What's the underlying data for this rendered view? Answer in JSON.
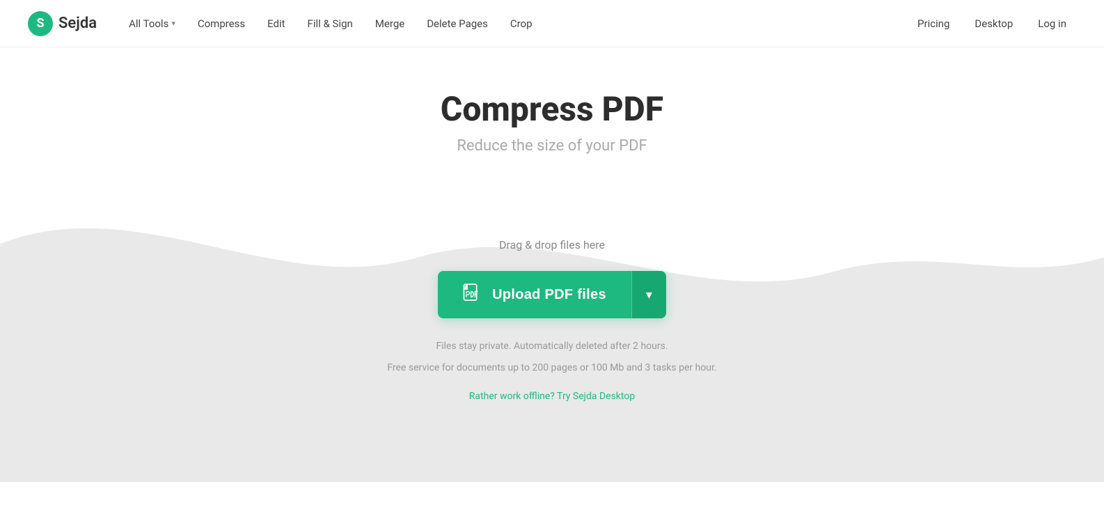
{
  "brand": {
    "logo_letter": "S",
    "name": "Sejda"
  },
  "nav": {
    "items": [
      {
        "label": "All Tools",
        "has_dropdown": true
      },
      {
        "label": "Compress",
        "has_dropdown": false
      },
      {
        "label": "Edit",
        "has_dropdown": false
      },
      {
        "label": "Fill & Sign",
        "has_dropdown": false
      },
      {
        "label": "Merge",
        "has_dropdown": false
      },
      {
        "label": "Delete Pages",
        "has_dropdown": false
      },
      {
        "label": "Crop",
        "has_dropdown": false
      }
    ],
    "right_items": [
      {
        "label": "Pricing"
      },
      {
        "label": "Desktop"
      },
      {
        "label": "Log in"
      }
    ]
  },
  "hero": {
    "title": "Compress PDF",
    "subtitle": "Reduce the size of your PDF"
  },
  "upload": {
    "drag_drop_text": "Drag & drop files here",
    "button_label": "Upload PDF files",
    "button_arrow": "▾",
    "privacy_line1": "Files stay private. Automatically deleted after 2 hours.",
    "privacy_line2": "Free service for documents up to 200 pages or 100 Mb and 3 tasks per hour.",
    "offline_link": "Rather work offline? Try Sejda Desktop"
  },
  "colors": {
    "brand_green": "#1eb980",
    "wave_bg": "#e8e8e8"
  }
}
